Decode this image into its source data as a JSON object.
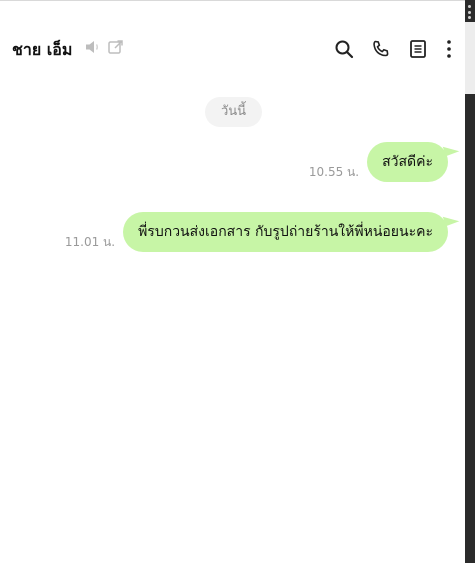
{
  "chat": {
    "title": "ชาย เอ็ม",
    "date_separator": "วันนี้"
  },
  "header_icons": [
    "speaker-muted-icon",
    "popout-icon",
    "search-icon",
    "phone-icon",
    "notes-icon",
    "more-vertical-icon"
  ],
  "messages": [
    {
      "text": "สวัสดีค่ะ",
      "time": "10.55 น."
    },
    {
      "text": "พี่รบกวนส่งเอกสาร  กับรูปถ่ายร้านให้พี่หน่อยนะคะ",
      "time": "11.01 น."
    }
  ],
  "colors": {
    "outgoing_bubble": "#c7f5a6",
    "date_chip": "#f3f3f3",
    "time_text": "#9a9a9a"
  }
}
